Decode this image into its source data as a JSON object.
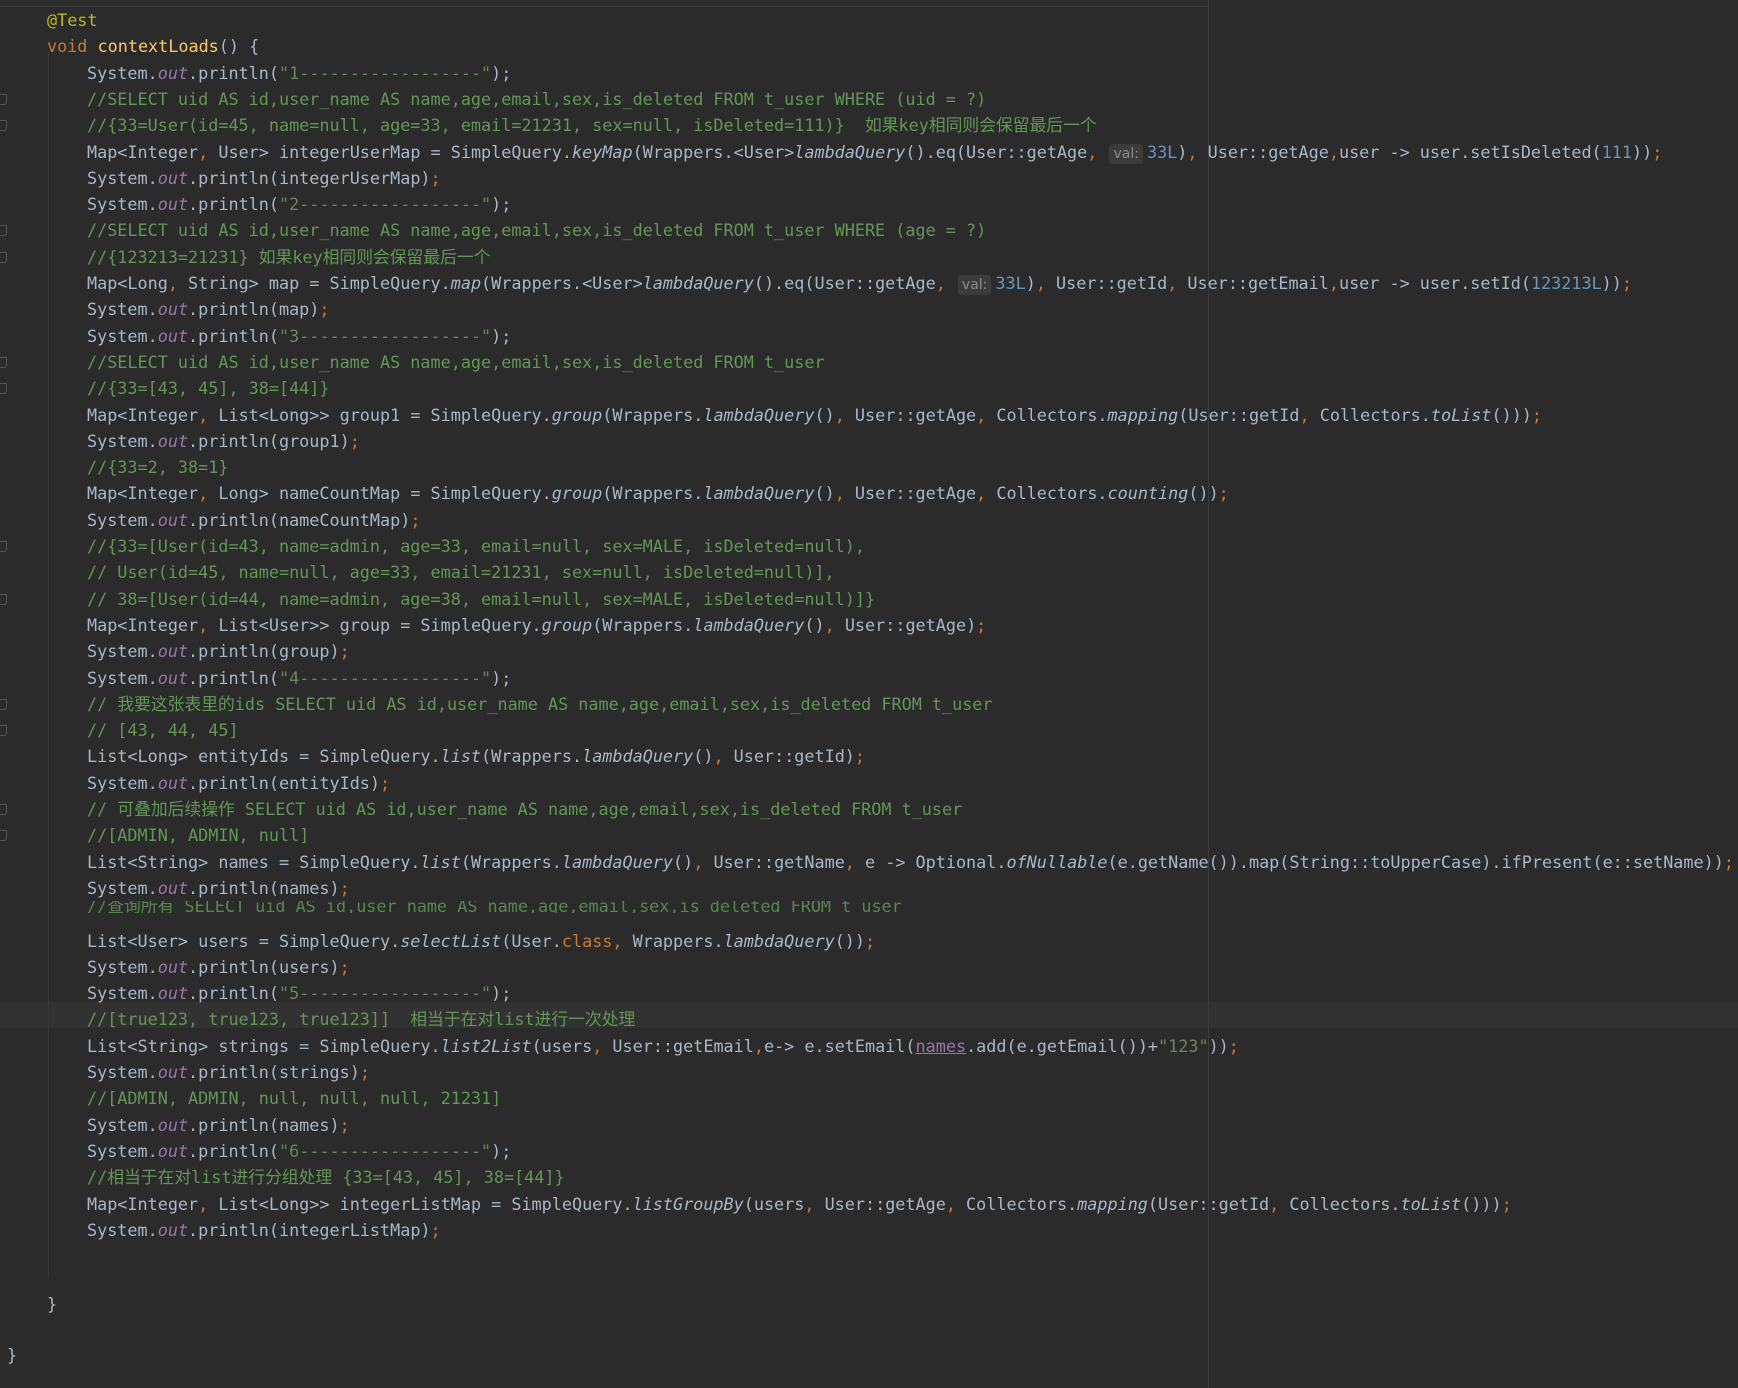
{
  "editor": {
    "theme": "dark",
    "colors": {
      "background": "#2b2b2b",
      "text": "#a9b7c6",
      "keyword": "#cc7832",
      "string": "#6a8759",
      "comment": "#629755",
      "number": "#6897bb",
      "annotation": "#bbb529",
      "method": "#ffc66d",
      "field": "#9876aa"
    },
    "caret_line": 39,
    "lines": [
      [
        {
          "t": "@Test",
          "c": "ann"
        }
      ],
      [
        {
          "t": "void ",
          "c": "kw"
        },
        {
          "t": "contextLoads",
          "c": "fn"
        },
        {
          "t": "() {"
        }
      ],
      [
        {
          "t": "System."
        },
        {
          "t": "out",
          "c": "field"
        },
        {
          "t": ".println("
        },
        {
          "t": "\"1------------------\"",
          "c": "str"
        },
        {
          "t": ");"
        }
      ],
      [
        {
          "t": "//SELECT uid AS id,user_name AS name,age,email,sex,is_deleted FROM t_user WHERE (uid = ?)",
          "c": "com"
        }
      ],
      [
        {
          "t": "//{33=User(id=45, name=null, age=33, email=21231, sex=null, isDeleted=111)}  如果key相同则会保留最后一个",
          "c": "com"
        }
      ],
      [
        {
          "t": "Map<Integer"
        },
        {
          "t": ", ",
          "c": "kw"
        },
        {
          "t": "User> integerUserMap = SimpleQuery."
        },
        {
          "t": "keyMap",
          "c": "static"
        },
        {
          "t": "(Wrappers.<User>"
        },
        {
          "t": "lambdaQuery",
          "c": "static"
        },
        {
          "t": "().eq(User::getAge"
        },
        {
          "t": ", ",
          "c": "kw"
        },
        {
          "t": "val:",
          "c": "hint"
        },
        {
          "t": "33L",
          "c": "num"
        },
        {
          "t": ")"
        },
        {
          "t": ", ",
          "c": "kw"
        },
        {
          "t": "User::getAge"
        },
        {
          "t": ",",
          "c": "kw"
        },
        {
          "t": "user -> user.setIsDeleted("
        },
        {
          "t": "111",
          "c": "num"
        },
        {
          "t": "))"
        },
        {
          "t": ";",
          "c": "kw"
        }
      ],
      [
        {
          "t": "System."
        },
        {
          "t": "out",
          "c": "field"
        },
        {
          "t": ".println(integerUserMap)"
        },
        {
          "t": ";",
          "c": "kw"
        }
      ],
      [
        {
          "t": "System."
        },
        {
          "t": "out",
          "c": "field"
        },
        {
          "t": ".println("
        },
        {
          "t": "\"2------------------\"",
          "c": "str"
        },
        {
          "t": ");"
        }
      ],
      [
        {
          "t": "//SELECT uid AS id,user_name AS name,age,email,sex,is_deleted FROM t_user WHERE (age = ?)",
          "c": "com"
        }
      ],
      [
        {
          "t": "//{123213=21231} 如果key相同则会保留最后一个",
          "c": "com"
        }
      ],
      [
        {
          "t": "Map<Long"
        },
        {
          "t": ", ",
          "c": "kw"
        },
        {
          "t": "String> map = SimpleQuery."
        },
        {
          "t": "map",
          "c": "static"
        },
        {
          "t": "(Wrappers.<User>"
        },
        {
          "t": "lambdaQuery",
          "c": "static"
        },
        {
          "t": "().eq(User::getAge"
        },
        {
          "t": ", ",
          "c": "kw"
        },
        {
          "t": "val:",
          "c": "hint"
        },
        {
          "t": "33L",
          "c": "num"
        },
        {
          "t": ")"
        },
        {
          "t": ", ",
          "c": "kw"
        },
        {
          "t": "User::getId"
        },
        {
          "t": ", ",
          "c": "kw"
        },
        {
          "t": "User::getEmail"
        },
        {
          "t": ",",
          "c": "kw"
        },
        {
          "t": "user -> user.setId("
        },
        {
          "t": "123213L",
          "c": "num"
        },
        {
          "t": "))"
        },
        {
          "t": ";",
          "c": "kw"
        }
      ],
      [
        {
          "t": "System."
        },
        {
          "t": "out",
          "c": "field"
        },
        {
          "t": ".println(map)"
        },
        {
          "t": ";",
          "c": "kw"
        }
      ],
      [
        {
          "t": "System."
        },
        {
          "t": "out",
          "c": "field"
        },
        {
          "t": ".println("
        },
        {
          "t": "\"3------------------\"",
          "c": "str"
        },
        {
          "t": ");"
        }
      ],
      [
        {
          "t": "//SELECT uid AS id,user_name AS name,age,email,sex,is_deleted FROM t_user",
          "c": "com"
        }
      ],
      [
        {
          "t": "//{33=[43, 45], 38=[44]}",
          "c": "com"
        }
      ],
      [
        {
          "t": "Map<Integer"
        },
        {
          "t": ", ",
          "c": "kw"
        },
        {
          "t": "List<Long>> group1 = SimpleQuery."
        },
        {
          "t": "group",
          "c": "static"
        },
        {
          "t": "(Wrappers."
        },
        {
          "t": "lambdaQuery",
          "c": "static"
        },
        {
          "t": "()"
        },
        {
          "t": ", ",
          "c": "kw"
        },
        {
          "t": "User::getAge"
        },
        {
          "t": ", ",
          "c": "kw"
        },
        {
          "t": "Collectors."
        },
        {
          "t": "mapping",
          "c": "static"
        },
        {
          "t": "(User::getId"
        },
        {
          "t": ", ",
          "c": "kw"
        },
        {
          "t": "Collectors."
        },
        {
          "t": "toList",
          "c": "static"
        },
        {
          "t": "()))"
        },
        {
          "t": ";",
          "c": "kw"
        }
      ],
      [
        {
          "t": "System."
        },
        {
          "t": "out",
          "c": "field"
        },
        {
          "t": ".println(group1)"
        },
        {
          "t": ";",
          "c": "kw"
        }
      ],
      [
        {
          "t": "//{33=2, 38=1}",
          "c": "com"
        }
      ],
      [
        {
          "t": "Map<Integer"
        },
        {
          "t": ", ",
          "c": "kw"
        },
        {
          "t": "Long> nameCountMap = SimpleQuery."
        },
        {
          "t": "group",
          "c": "static"
        },
        {
          "t": "(Wrappers."
        },
        {
          "t": "lambdaQuery",
          "c": "static"
        },
        {
          "t": "()"
        },
        {
          "t": ", ",
          "c": "kw"
        },
        {
          "t": "User::getAge"
        },
        {
          "t": ", ",
          "c": "kw"
        },
        {
          "t": "Collectors."
        },
        {
          "t": "counting",
          "c": "static"
        },
        {
          "t": "())"
        },
        {
          "t": ";",
          "c": "kw"
        }
      ],
      [
        {
          "t": "System."
        },
        {
          "t": "out",
          "c": "field"
        },
        {
          "t": ".println(nameCountMap)"
        },
        {
          "t": ";",
          "c": "kw"
        }
      ],
      [
        {
          "t": "//{33=[User(id=43, name=admin, age=33, email=null, sex=MALE, isDeleted=null),",
          "c": "com"
        }
      ],
      [
        {
          "t": "// User(id=45, name=null, age=33, email=21231, sex=null, isDeleted=null)],",
          "c": "com"
        }
      ],
      [
        {
          "t": "// 38=[User(id=44, name=admin, age=38, email=null, sex=MALE, isDeleted=null)]}",
          "c": "com"
        }
      ],
      [
        {
          "t": "Map<Integer"
        },
        {
          "t": ", ",
          "c": "kw"
        },
        {
          "t": "List<User>> group = SimpleQuery."
        },
        {
          "t": "group",
          "c": "static"
        },
        {
          "t": "(Wrappers."
        },
        {
          "t": "lambdaQuery",
          "c": "static"
        },
        {
          "t": "()"
        },
        {
          "t": ", ",
          "c": "kw"
        },
        {
          "t": "User::getAge)"
        },
        {
          "t": ";",
          "c": "kw"
        }
      ],
      [
        {
          "t": "System."
        },
        {
          "t": "out",
          "c": "field"
        },
        {
          "t": ".println(group)"
        },
        {
          "t": ";",
          "c": "kw"
        }
      ],
      [
        {
          "t": "System."
        },
        {
          "t": "out",
          "c": "field"
        },
        {
          "t": ".println("
        },
        {
          "t": "\"4------------------\"",
          "c": "str"
        },
        {
          "t": ");"
        }
      ],
      [
        {
          "t": "// 我要这张表里的ids SELECT uid AS id,user_name AS name,age,email,sex,is_deleted FROM t_user",
          "c": "com"
        }
      ],
      [
        {
          "t": "// [43, 44, 45]",
          "c": "com"
        }
      ],
      [
        {
          "t": "List<Long> entityIds = SimpleQuery."
        },
        {
          "t": "list",
          "c": "static"
        },
        {
          "t": "(Wrappers."
        },
        {
          "t": "lambdaQuery",
          "c": "static"
        },
        {
          "t": "()"
        },
        {
          "t": ", ",
          "c": "kw"
        },
        {
          "t": "User::getId)"
        },
        {
          "t": ";",
          "c": "kw"
        }
      ],
      [
        {
          "t": "System."
        },
        {
          "t": "out",
          "c": "field"
        },
        {
          "t": ".println(entityIds)"
        },
        {
          "t": ";",
          "c": "kw"
        }
      ],
      [
        {
          "t": "// 可叠加后续操作 SELECT uid AS id,user_name AS name,age,email,sex,is_deleted FROM t_user",
          "c": "com"
        }
      ],
      [
        {
          "t": "//[ADMIN, ADMIN, null]",
          "c": "com"
        }
      ],
      [
        {
          "t": "List<String> names = SimpleQuery."
        },
        {
          "t": "list",
          "c": "static"
        },
        {
          "t": "(Wrappers."
        },
        {
          "t": "lambdaQuery",
          "c": "static"
        },
        {
          "t": "()"
        },
        {
          "t": ", ",
          "c": "kw"
        },
        {
          "t": "User::getName"
        },
        {
          "t": ", ",
          "c": "kw"
        },
        {
          "t": "e -> Optional."
        },
        {
          "t": "ofNullable",
          "c": "static"
        },
        {
          "t": "(e.getName()).map(String::toUpperCase).ifPresent(e::setName))"
        },
        {
          "t": ";",
          "c": "kw"
        }
      ],
      [
        {
          "t": "System."
        },
        {
          "t": "out",
          "c": "field"
        },
        {
          "t": ".println(names)"
        },
        {
          "t": ";",
          "c": "kw"
        }
      ],
      [
        {
          "t": "//查询所有 SELECT uid AS id,user_name AS name,age,email,sex,is_deleted FROM t_user",
          "c": "clip"
        }
      ],
      [
        {
          "t": "List<User> users = SimpleQuery."
        },
        {
          "t": "selectList",
          "c": "static"
        },
        {
          "t": "(User."
        },
        {
          "t": "class",
          "c": "kw"
        },
        {
          "t": ", ",
          "c": "kw"
        },
        {
          "t": "Wrappers."
        },
        {
          "t": "lambdaQuery",
          "c": "static"
        },
        {
          "t": "())"
        },
        {
          "t": ";",
          "c": "kw"
        }
      ],
      [
        {
          "t": "System."
        },
        {
          "t": "out",
          "c": "field"
        },
        {
          "t": ".println(users)"
        },
        {
          "t": ";",
          "c": "kw"
        }
      ],
      [
        {
          "t": "System."
        },
        {
          "t": "out",
          "c": "field"
        },
        {
          "t": ".println("
        },
        {
          "t": "\"5------------------\"",
          "c": "str"
        },
        {
          "t": ");"
        }
      ],
      [
        {
          "t": "//[true123, true123, true123]]  相当于在对list进行一次处理",
          "c": "com"
        }
      ],
      [
        {
          "t": "List<String> strings = SimpleQuery."
        },
        {
          "t": "list2List",
          "c": "static"
        },
        {
          "t": "(users"
        },
        {
          "t": ", ",
          "c": "kw"
        },
        {
          "t": "User::getEmail"
        },
        {
          "t": ",",
          "c": "kw"
        },
        {
          "t": "e-> e.setEmail("
        },
        {
          "t": "names",
          "c": "under"
        },
        {
          "t": ".add(e.getEmail())+"
        },
        {
          "t": "\"123\"",
          "c": "str"
        },
        {
          "t": "))"
        },
        {
          "t": ";",
          "c": "kw"
        }
      ],
      [
        {
          "t": "System."
        },
        {
          "t": "out",
          "c": "field"
        },
        {
          "t": ".println(strings)"
        },
        {
          "t": ";",
          "c": "kw"
        }
      ],
      [
        {
          "t": "//[ADMIN, ADMIN, null, null, null, 21231]",
          "c": "com"
        }
      ],
      [
        {
          "t": "System."
        },
        {
          "t": "out",
          "c": "field"
        },
        {
          "t": ".println(names)"
        },
        {
          "t": ";",
          "c": "kw"
        }
      ],
      [
        {
          "t": "System."
        },
        {
          "t": "out",
          "c": "field"
        },
        {
          "t": ".println("
        },
        {
          "t": "\"6------------------\"",
          "c": "str"
        },
        {
          "t": ");"
        }
      ],
      [
        {
          "t": "//相当于在对list进行分组处理 {33=[43, 45], 38=[44]}",
          "c": "com"
        }
      ],
      [
        {
          "t": "Map<Integer"
        },
        {
          "t": ", ",
          "c": "kw"
        },
        {
          "t": "List<Long>> integerListMap = SimpleQuery."
        },
        {
          "t": "listGroupBy",
          "c": "static"
        },
        {
          "t": "(users"
        },
        {
          "t": ", ",
          "c": "kw"
        },
        {
          "t": "User::getAge"
        },
        {
          "t": ", ",
          "c": "kw"
        },
        {
          "t": "Collectors."
        },
        {
          "t": "mapping",
          "c": "static"
        },
        {
          "t": "(User::getId"
        },
        {
          "t": ", ",
          "c": "kw"
        },
        {
          "t": "Collectors."
        },
        {
          "t": "toList",
          "c": "static"
        },
        {
          "t": "()))"
        },
        {
          "t": ";",
          "c": "kw"
        }
      ],
      [
        {
          "t": "System."
        },
        {
          "t": "out",
          "c": "field"
        },
        {
          "t": ".println(integerListMap)"
        },
        {
          "t": ";",
          "c": "kw"
        }
      ],
      [
        {
          "t": "}"
        }
      ],
      [
        {
          "t": "}"
        }
      ]
    ]
  }
}
